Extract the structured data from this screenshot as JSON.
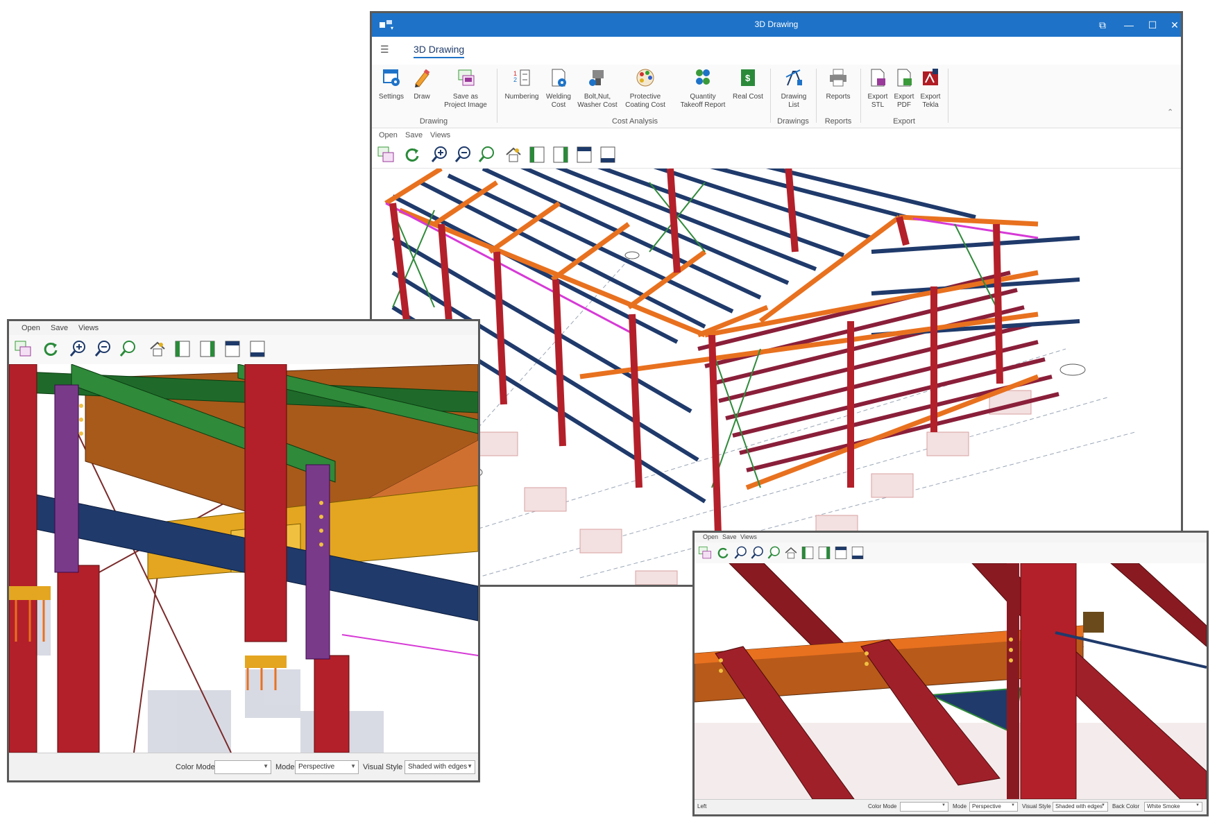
{
  "main_window": {
    "title": "3D Drawing",
    "tab": "3D Drawing",
    "ribbon": {
      "settings": "Settings",
      "draw": "Draw",
      "save_project_image_1": "Save as",
      "save_project_image_2": "Project Image",
      "numbering": "Numbering",
      "welding_cost_1": "Welding",
      "welding_cost_2": "Cost",
      "bolt_cost_1": "Bolt,Nut,",
      "bolt_cost_2": "Washer Cost",
      "coating_cost_1": "Protective",
      "coating_cost_2": "Coating Cost",
      "quantity_1": "Quantity",
      "quantity_2": "Takeoff Report",
      "real_cost": "Real Cost",
      "drawing_list_1": "Drawing",
      "drawing_list_2": "List",
      "reports": "Reports",
      "export_stl_1": "Export",
      "export_stl_2": "STL",
      "export_pdf_1": "Export",
      "export_pdf_2": "PDF",
      "export_tekla_1": "Export",
      "export_tekla_2": "Tekla",
      "groups": {
        "drawing": "Drawing",
        "cost_analysis": "Cost Analysis",
        "drawings": "Drawings",
        "reports": "Reports",
        "export": "Export"
      }
    },
    "menu": {
      "open": "Open",
      "save": "Save",
      "views": "Views"
    }
  },
  "left_window": {
    "menu": {
      "open": "Open",
      "save": "Save",
      "views": "Views"
    },
    "status": {
      "color_mode_label": "Color Mode",
      "color_mode_value": "",
      "mode_label": "Mode",
      "mode_value": "Perspective",
      "visual_style_label": "Visual Style",
      "visual_style_value": "Shaded with edges"
    }
  },
  "right_window": {
    "menu": {
      "open": "Open",
      "save": "Save",
      "views": "Views"
    },
    "status": {
      "left_text": "Left",
      "color_mode_label": "Color Mode",
      "color_mode_value": "",
      "mode_label": "Mode",
      "mode_value": "Perspective",
      "visual_style_label": "Visual Style",
      "visual_style_value": "Shaded with edges",
      "back_color_label": "Back Color",
      "back_color_value": "White Smoke"
    }
  },
  "colors": {
    "titlebar": "#1e73c8",
    "column_red": "#b3202a",
    "beam_orange": "#e8711f",
    "purlin_navy": "#1f3a6b",
    "bracing_green": "#2f8a3a",
    "floor_maroon": "#8a1f3a",
    "magenta": "#d63ad6"
  }
}
